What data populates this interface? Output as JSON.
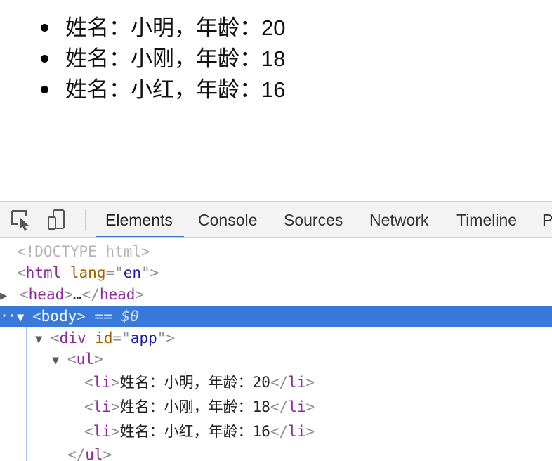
{
  "page": {
    "list": [
      "姓名：小明，年龄：20",
      "姓名：小刚，年龄：18",
      "姓名：小红，年龄：16"
    ]
  },
  "devtools": {
    "tabs": [
      "Elements",
      "Console",
      "Sources",
      "Network",
      "Timeline",
      "P"
    ],
    "active_tab": "Elements",
    "icons": [
      "inspect-element-icon",
      "device-toggle-icon"
    ],
    "dom": {
      "doctype": "<!DOCTYPE html>",
      "html_tag": "html",
      "html_attr": "lang",
      "html_attr_val": "en",
      "head_tag": "head",
      "ellipsis": "…",
      "body_tag": "body",
      "selected_marker": "== $0",
      "div_tag": "div",
      "div_attr": "id",
      "div_attr_val": "app",
      "ul_tag": "ul",
      "li_tag": "li",
      "li_texts": [
        "姓名：小明，年龄：20",
        "姓名：小刚，年龄：18",
        "姓名：小红，年龄：16"
      ]
    },
    "colors": {
      "selection": "#3879d9",
      "tag": "#8f2a9c",
      "attr": "#a55e00",
      "value": "#1a1aa6"
    }
  }
}
